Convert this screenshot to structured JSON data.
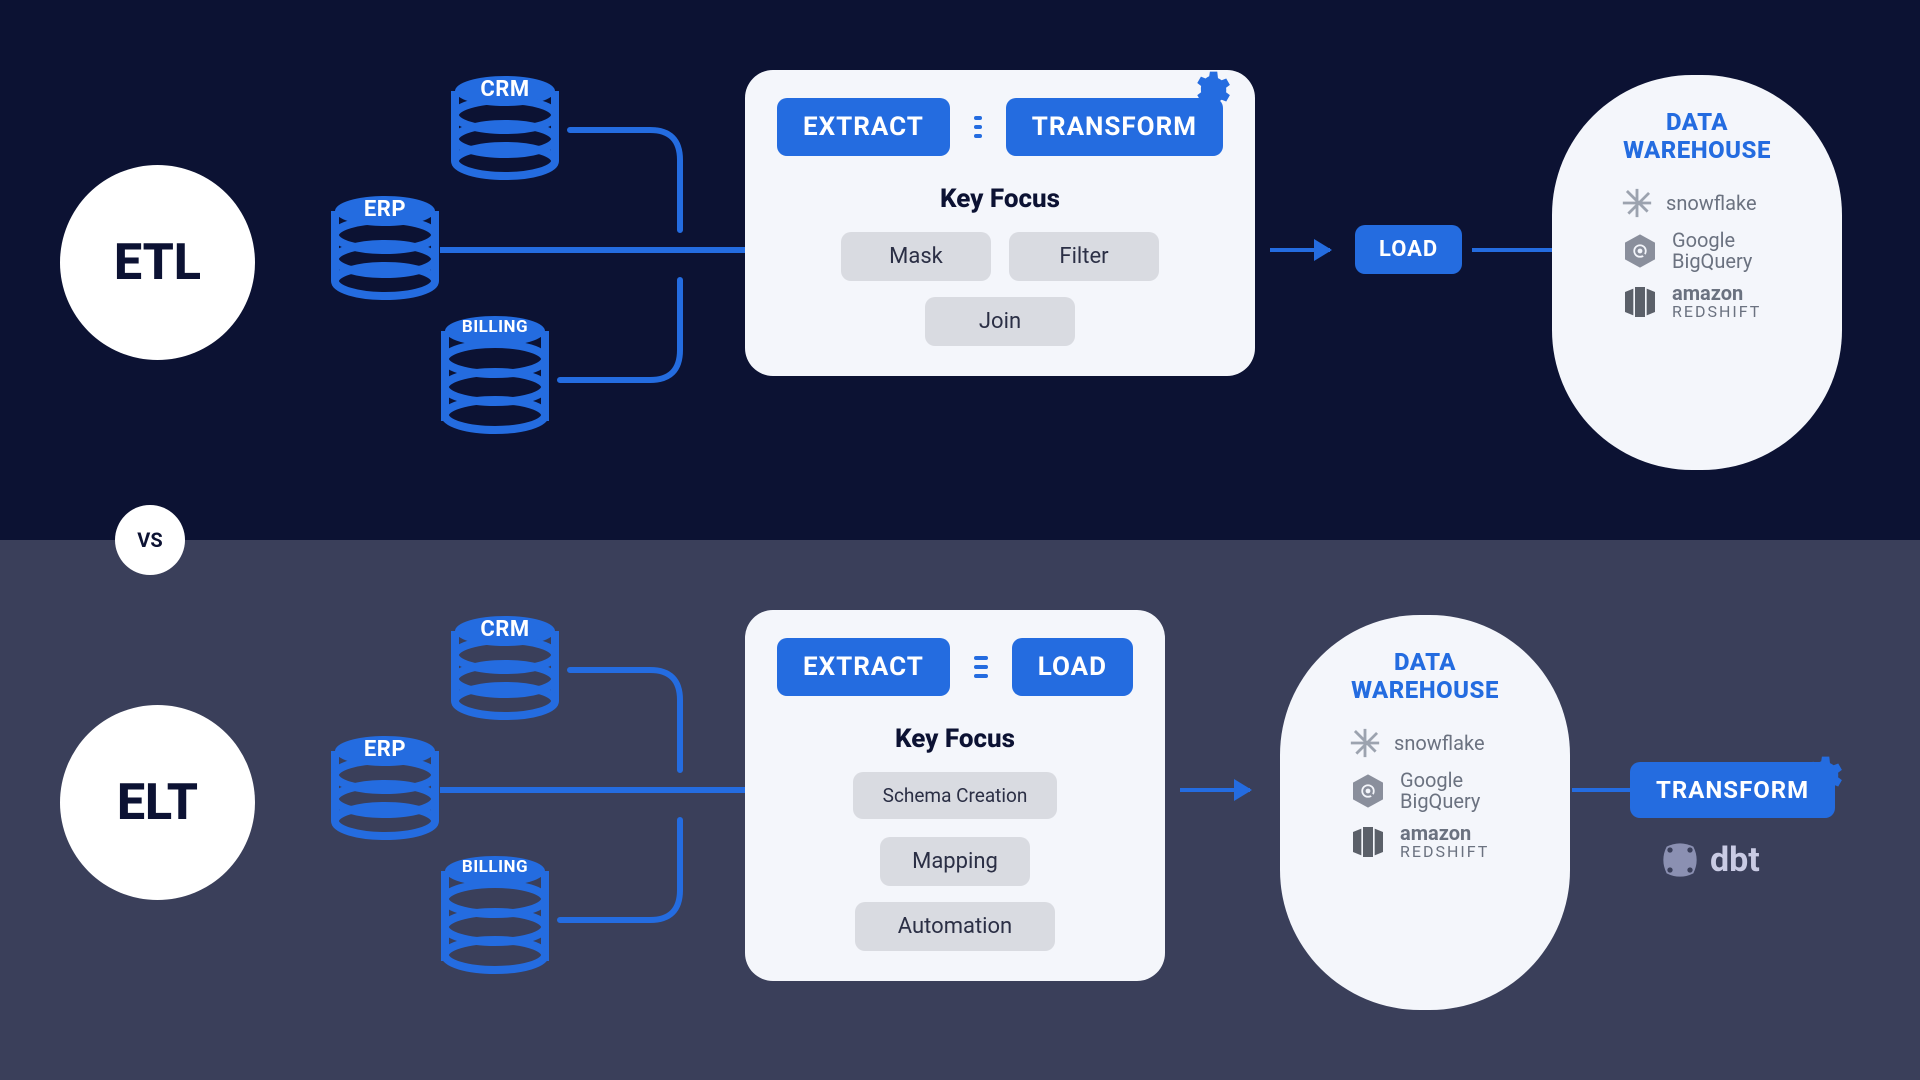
{
  "vs_label": "VS",
  "etl": {
    "title": "ETL",
    "sources": [
      "CRM",
      "ERP",
      "BILLING"
    ],
    "panel": {
      "step1": "EXTRACT",
      "step2": "TRANSFORM",
      "key_focus_title": "Key Focus",
      "focus": [
        "Mask",
        "Filter",
        "Join"
      ]
    },
    "load_label": "LOAD",
    "warehouse": {
      "title_l1": "DATA",
      "title_l2": "WAREHOUSE",
      "items": [
        {
          "brand_l1": "snowflake",
          "brand_l2": ""
        },
        {
          "brand_l1": "Google",
          "brand_l2": "BigQuery"
        },
        {
          "brand_l1": "amazon",
          "brand_l2": "REDSHIFT"
        }
      ]
    }
  },
  "elt": {
    "title": "ELT",
    "sources": [
      "CRM",
      "ERP",
      "BILLING"
    ],
    "panel": {
      "step1": "EXTRACT",
      "step2": "LOAD",
      "key_focus_title": "Key Focus",
      "focus": [
        "Schema Creation",
        "Mapping",
        "Automation"
      ]
    },
    "warehouse": {
      "title_l1": "DATA",
      "title_l2": "WAREHOUSE",
      "items": [
        {
          "brand_l1": "snowflake",
          "brand_l2": ""
        },
        {
          "brand_l1": "Google",
          "brand_l2": "BigQuery"
        },
        {
          "brand_l1": "amazon",
          "brand_l2": "REDSHIFT"
        }
      ]
    },
    "transform_label": "TRANSFORM",
    "dbt_label": "dbt"
  }
}
